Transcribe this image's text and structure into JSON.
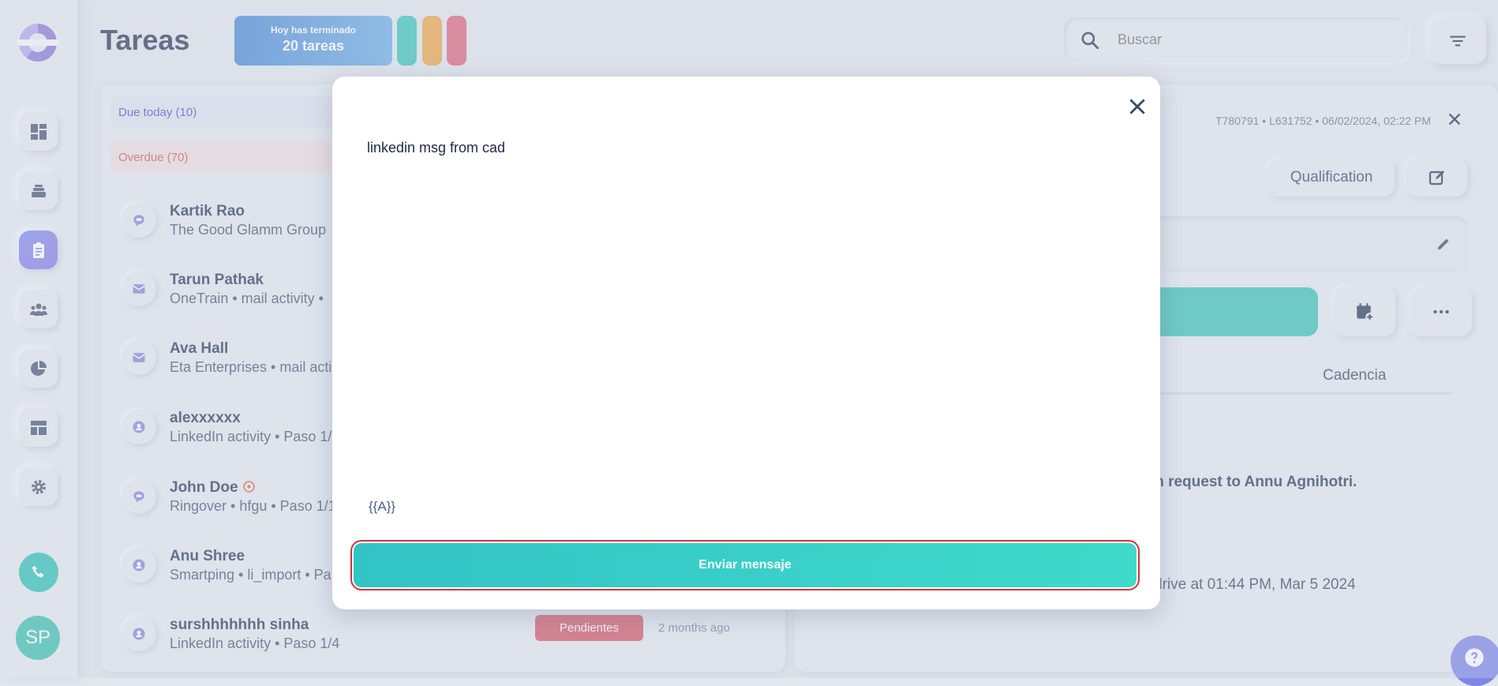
{
  "header": {
    "title": "Tareas",
    "stat_line1": "Hoy has terminado",
    "stat_line2": "20 tareas",
    "pills": [
      "#3dc6b8",
      "#eea848",
      "#e0667f"
    ],
    "search_placeholder": "Buscar"
  },
  "sidebar": {
    "items": [
      "dashboard-icon",
      "layers-icon",
      "tasks-icon",
      "contacts-icon",
      "pie-chart-icon",
      "layout-icon",
      "gear-icon"
    ],
    "active_index": 2,
    "avatar_initials": "SP"
  },
  "tasks": {
    "due_today": "Due today (10)",
    "overdue": "Overdue (70)",
    "rows": [
      {
        "name": "Kartik Rao",
        "sub": "The Good Glamm Group",
        "icon": "chat-icon"
      },
      {
        "name": "Tarun Pathak",
        "sub": "OneTrain • mail activity •",
        "icon": "mail-icon"
      },
      {
        "name": "Ava Hall",
        "sub": "Eta Enterprises • mail acti",
        "icon": "mail-icon"
      },
      {
        "name": "alexxxxxx",
        "sub": "LinkedIn activity • Paso 1/",
        "icon": "person-icon"
      },
      {
        "name": "John Doe",
        "sub": "Ringover • hfgu • Paso 1/1",
        "icon": "chat-icon"
      },
      {
        "name": "Anu Shree",
        "sub": "Smartping • li_import • Pa",
        "icon": "person-icon"
      },
      {
        "name": "surshhhhhhh sinha",
        "sub": "LinkedIn activity • Paso 1/4",
        "icon": "person-icon",
        "badge": "Pendientes",
        "ago": "2 months ago"
      }
    ]
  },
  "detail": {
    "meta": "T780791 • L631752 • 06/02/2024, 02:22 PM",
    "qualification": "Qualification",
    "tab_cadencia": "Cadencia",
    "text1": "tion request to Annu Agnihotri.",
    "text2": "drive at 01:44 PM, Mar 5 2024"
  },
  "modal": {
    "message": "linkedin msg from cad",
    "placeholder_tag": "{{A}}",
    "send_label": "Enviar mensaje"
  },
  "colors": {
    "accent": "#8a7bd6",
    "teal": "#3cc4b6",
    "danger": "#d65a67",
    "link": "#4a54c9",
    "overdue": "#d45a50"
  }
}
